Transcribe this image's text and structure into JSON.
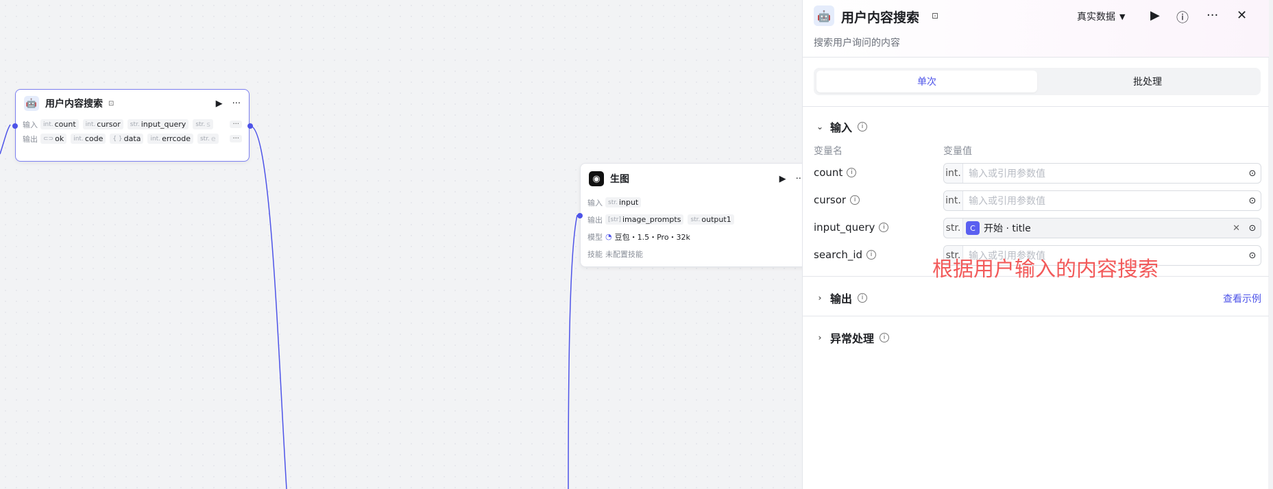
{
  "node_search": {
    "title": "用户内容搜索",
    "input_label": "输入",
    "output_label": "输出",
    "inputs": [
      {
        "type": "int.",
        "name": "count"
      },
      {
        "type": "int.",
        "name": "cursor"
      },
      {
        "type": "str.",
        "name": "input_query"
      },
      {
        "type": "str.",
        "name": "s"
      }
    ],
    "outputs": [
      {
        "type": "",
        "name": "ok"
      },
      {
        "type": "int.",
        "name": "code"
      },
      {
        "type": "{ }",
        "name": "data"
      },
      {
        "type": "int.",
        "name": "errcode"
      },
      {
        "type": "str.",
        "name": "e"
      }
    ],
    "more": "···"
  },
  "node_image": {
    "title": "生图",
    "input_label": "输入",
    "output_label": "输出",
    "model_label": "模型",
    "skill_label": "技能",
    "inputs": [
      {
        "type": "str.",
        "name": "input"
      }
    ],
    "outputs": [
      {
        "type": "[str]",
        "name": "image_prompts"
      },
      {
        "type": "str.",
        "name": "output1"
      }
    ],
    "model": "豆包・1.5・Pro・32k",
    "skill": "未配置技能"
  },
  "panel": {
    "title": "用户内容搜索",
    "description": "搜索用户询问的内容",
    "dataset": "真实数据",
    "tabs": [
      "单次",
      "批处理"
    ],
    "input_section": "输入",
    "col_name": "变量名",
    "col_value": "变量值",
    "params": [
      {
        "name": "count",
        "type": "int.",
        "placeholder": "输入或引用参数值"
      },
      {
        "name": "cursor",
        "type": "int.",
        "placeholder": "输入或引用参数值"
      },
      {
        "name": "input_query",
        "type": "str.",
        "ref": "开始 · title"
      },
      {
        "name": "search_id",
        "type": "str.",
        "placeholder": "输入或引用参数值"
      }
    ],
    "output_section": "输出",
    "view_example": "查看示例",
    "exception_section": "异常处理",
    "overlay_note": "根据用户输入的内容搜索"
  },
  "colors": {
    "accent": "#4d53e8",
    "overlay": "#f25a5a"
  }
}
